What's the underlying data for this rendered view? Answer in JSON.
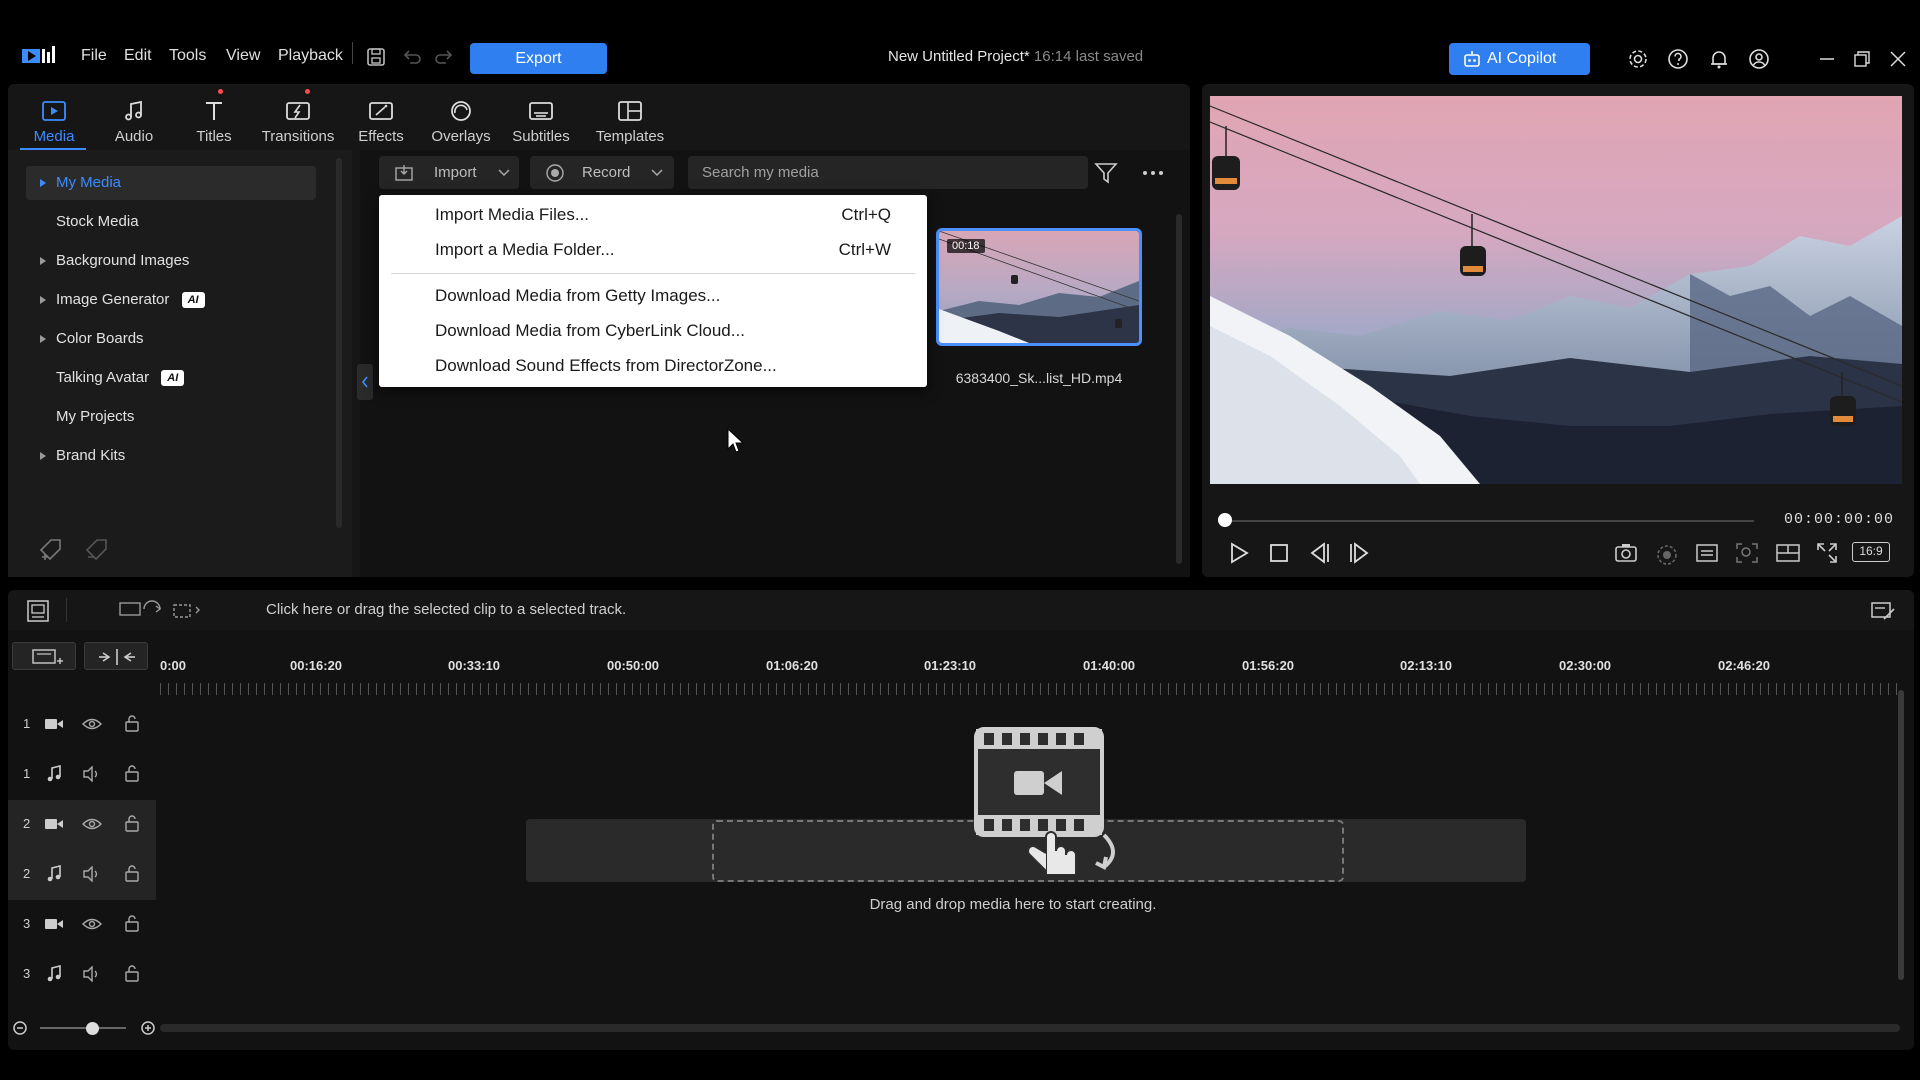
{
  "menu": {
    "file": "File",
    "edit": "Edit",
    "tools": "Tools",
    "view": "View",
    "playback": "Playback",
    "export": "Export"
  },
  "project": {
    "title": "New Untitled Project*",
    "saved": "16:14 last saved"
  },
  "copilot": {
    "label": "AI Copilot"
  },
  "tabs": [
    {
      "label": "Media",
      "icon": "media-icon"
    },
    {
      "label": "Audio",
      "icon": "music-note-icon"
    },
    {
      "label": "Titles",
      "icon": "text-t-icon"
    },
    {
      "label": "Transitions",
      "icon": "transitions-icon"
    },
    {
      "label": "Effects",
      "icon": "effects-icon"
    },
    {
      "label": "Overlays",
      "icon": "overlays-icon"
    },
    {
      "label": "Subtitles",
      "icon": "subtitles-icon"
    },
    {
      "label": "Templates",
      "icon": "templates-icon"
    }
  ],
  "sidebar": {
    "items": [
      {
        "label": "My Media"
      },
      {
        "label": "Stock Media"
      },
      {
        "label": "Background Images"
      },
      {
        "label": "Image Generator",
        "badge": "AI"
      },
      {
        "label": "Color Boards"
      },
      {
        "label": "Talking Avatar",
        "badge": "AI"
      },
      {
        "label": "My Projects"
      },
      {
        "label": "Brand Kits"
      }
    ]
  },
  "media_toolbar": {
    "import": "Import",
    "record": "Record",
    "search_placeholder": "Search my media"
  },
  "import_menu": {
    "items": [
      {
        "label": "Import Media Files...",
        "shortcut": "Ctrl+Q"
      },
      {
        "label": "Import a Media Folder...",
        "shortcut": "Ctrl+W"
      },
      {
        "label": "Download Media from Getty Images..."
      },
      {
        "label": "Download Media from CyberLink Cloud..."
      },
      {
        "label": "Download Sound Effects from DirectorZone..."
      }
    ]
  },
  "media_item": {
    "duration": "00:18",
    "name": "6383400_Sk...list_HD.mp4"
  },
  "preview": {
    "timecode": "00:00:00:00",
    "aspect": "16:9",
    "position_fraction": 0
  },
  "timeline": {
    "hint": "Click here or drag the selected clip to a selected track.",
    "ruler": [
      "0:00",
      "00:16:20",
      "00:33:10",
      "00:50:00",
      "01:06:20",
      "01:23:10",
      "01:40:00",
      "01:56:20",
      "02:13:10",
      "02:30:00",
      "02:46:20"
    ],
    "tracks": [
      {
        "num": "1",
        "type": "video"
      },
      {
        "num": "1",
        "type": "audio"
      },
      {
        "num": "2",
        "type": "video"
      },
      {
        "num": "2",
        "type": "audio"
      },
      {
        "num": "3",
        "type": "video"
      },
      {
        "num": "3",
        "type": "audio"
      }
    ],
    "drop_text": "Drag and drop media here to start creating."
  },
  "colors": {
    "accent": "#2f7ff0",
    "active_tab": "#3d8cff",
    "panel": "#161616"
  }
}
